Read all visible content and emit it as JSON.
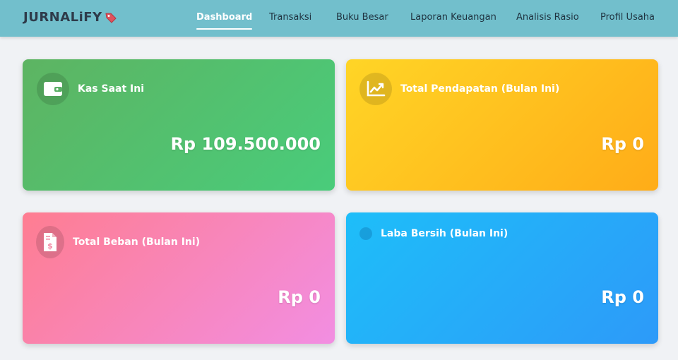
{
  "brand": {
    "name": "JURNALiFY",
    "icon": "bookmark-icon"
  },
  "nav": {
    "items": [
      {
        "label": "Dashboard",
        "active": true
      },
      {
        "label": "Transaksi",
        "active": false
      },
      {
        "label": "Buku Besar",
        "active": false
      },
      {
        "label": "Laporan Keuangan",
        "active": false
      },
      {
        "label": "Analisis Rasio",
        "active": false
      },
      {
        "label": "Profil Usaha",
        "active": false
      }
    ]
  },
  "cards": {
    "kas": {
      "title": "Kas Saat Ini",
      "value": "Rp 109.500.000",
      "icon": "wallet-icon",
      "color": "#4fbf6e"
    },
    "pendapatan": {
      "title": "Total Pendapatan (Bulan Ini)",
      "value": "Rp 0",
      "icon": "chart-line-icon",
      "color": "#ffc21f"
    },
    "beban": {
      "title": "Total Beban (Bulan Ini)",
      "value": "Rp 0",
      "icon": "invoice-dollar-icon",
      "color": "#f885b6"
    },
    "laba": {
      "title": "Laba Bersih (Bulan Ini)",
      "value": "Rp 0",
      "icon": "circle-icon",
      "color": "#25acf9"
    }
  },
  "colors": {
    "navbar": "#72bfcc",
    "background": "#f0f2f5"
  }
}
